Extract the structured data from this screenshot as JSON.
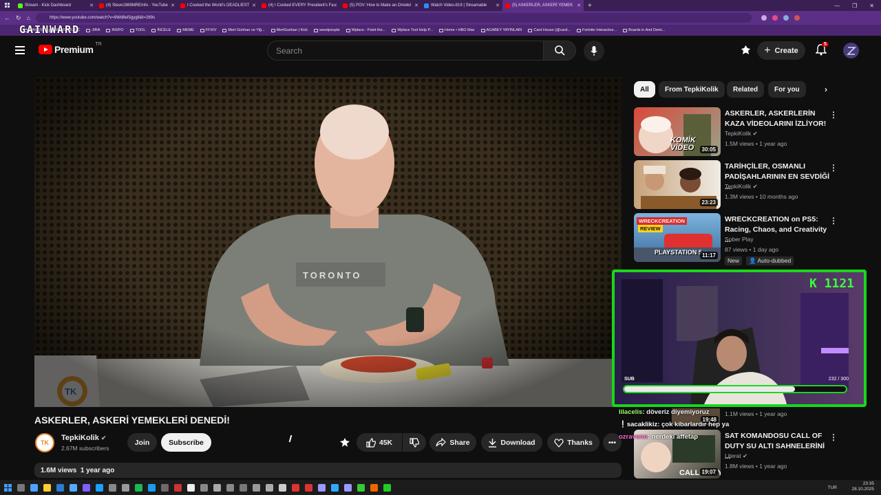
{
  "browser": {
    "tabs": [
      {
        "label": "Stream - Kick Dashboard",
        "color": "#53fc18"
      },
      {
        "label": "(4) Steve1989MREInfo - YouTube",
        "color": "#ff0000"
      },
      {
        "label": "I Cooked the World's DEADLIEST",
        "color": "#ff0000"
      },
      {
        "label": "(4) I Cooked EVERY President's Fa",
        "color": "#ff0000"
      },
      {
        "label": "(5) POV: How to Make an Omelet",
        "color": "#ff0000"
      },
      {
        "label": "Watch Video-819 | Streamable",
        "color": "#2d8cff"
      },
      {
        "label": "(5) ASKERLER, ASKERİ YEMEK",
        "color": "#ff0000"
      }
    ],
    "url": "https://www.youtube.com/watch?v=8Wd8eI5gyg8&t=269s",
    "bookmarks": [
      "GAMES",
      "WEIRD MUSIC",
      "JIRA",
      "INSPO",
      "TOOL",
      "İNCELE",
      "MEME",
      "FFXIV",
      "Mert Günhan ve Yiğ...",
      "MertGunhan | Kick",
      "weedpeople",
      "Wplace - Paint the...",
      "Wplace Tool Help P...",
      "Home • HBO Max",
      "AGABEY YAYINLARI",
      "Card House (@card...",
      "Fortnite Interactive...",
      "Boards in And Demi..."
    ],
    "overlay_logo": "GAINWARD"
  },
  "header": {
    "logo": "Premium",
    "logo_suffix": "TR",
    "search_placeholder": "Search",
    "create_label": "Create",
    "notif_count": "5"
  },
  "video": {
    "title": "ASKERLER, ASKERİ YEMEKLERİ DENEDİ!",
    "channel": "TepkiKolik",
    "avatar_text": "TK",
    "subscribers": "2.67M subscribers",
    "join": "Join",
    "subscribe": "Subscribe",
    "likes": "45K",
    "share": "Share",
    "download": "Download",
    "thanks": "Thanks",
    "views": "1.6M views",
    "age": "1 year ago",
    "shirt_text": "TORONTO"
  },
  "chips": [
    "All",
    "From TepkiKolik",
    "Related",
    "For you"
  ],
  "recommendations": [
    {
      "title": "ASKERLER, ASKERLERİN KAZA VİDEOLARINI İZLİYOR!",
      "channel": "TepkiKolik",
      "meta": "1.5M views • 1 year ago",
      "duration": "30:05",
      "badge": "KOMİK VİDEO"
    },
    {
      "title": "TARİHÇİLER, OSMANLI PADİŞAHLARININ EN SEVDİĞİ ...",
      "channel": "TepkiKolik",
      "meta": "1.3M views • 10 months ago",
      "duration": "23:23"
    },
    {
      "title": "WRECKCREATION on PS5: Racing, Chaos, and Creativity ...",
      "channel": "Sober Play",
      "meta": "87 views • 1 day ago",
      "duration": "11:17",
      "new": "New",
      "dub": "Auto-dubbed",
      "badge1": "WRECKCREATION",
      "badge2": "REVIEW",
      "badge3": "PLAYSTATION 5"
    },
    {
      "title": "",
      "channel": "",
      "meta": "1.1M views • 1 year ago",
      "duration": "19:48"
    },
    {
      "title": "SAT KOMANDOSU CALL OF DUTY SU ALTI SAHNELERİNİ ...",
      "channel": "Literat",
      "meta": "1.8M views • 1 year ago",
      "duration": "19:07"
    }
  ],
  "stream": {
    "counter": "K 1121",
    "sub_label": "SUB",
    "sub_count": "232 / 300",
    "sub_progress": 0.77,
    "chat": [
      {
        "user": "lilacelis",
        "msg": ": döveriz diyemiyoruz",
        "color": "#9dff6a"
      },
      {
        "user": "sacaklikiz",
        "msg": ": çok kibarlardır hep ya",
        "color": "#ffffff"
      },
      {
        "user": "ozravenn",
        "msg": ": nerdeki affetap",
        "color": "#ff6ad5"
      }
    ]
  },
  "taskbar": {
    "lang": "TUR",
    "time": "23:35",
    "date": "28.10.2025"
  }
}
